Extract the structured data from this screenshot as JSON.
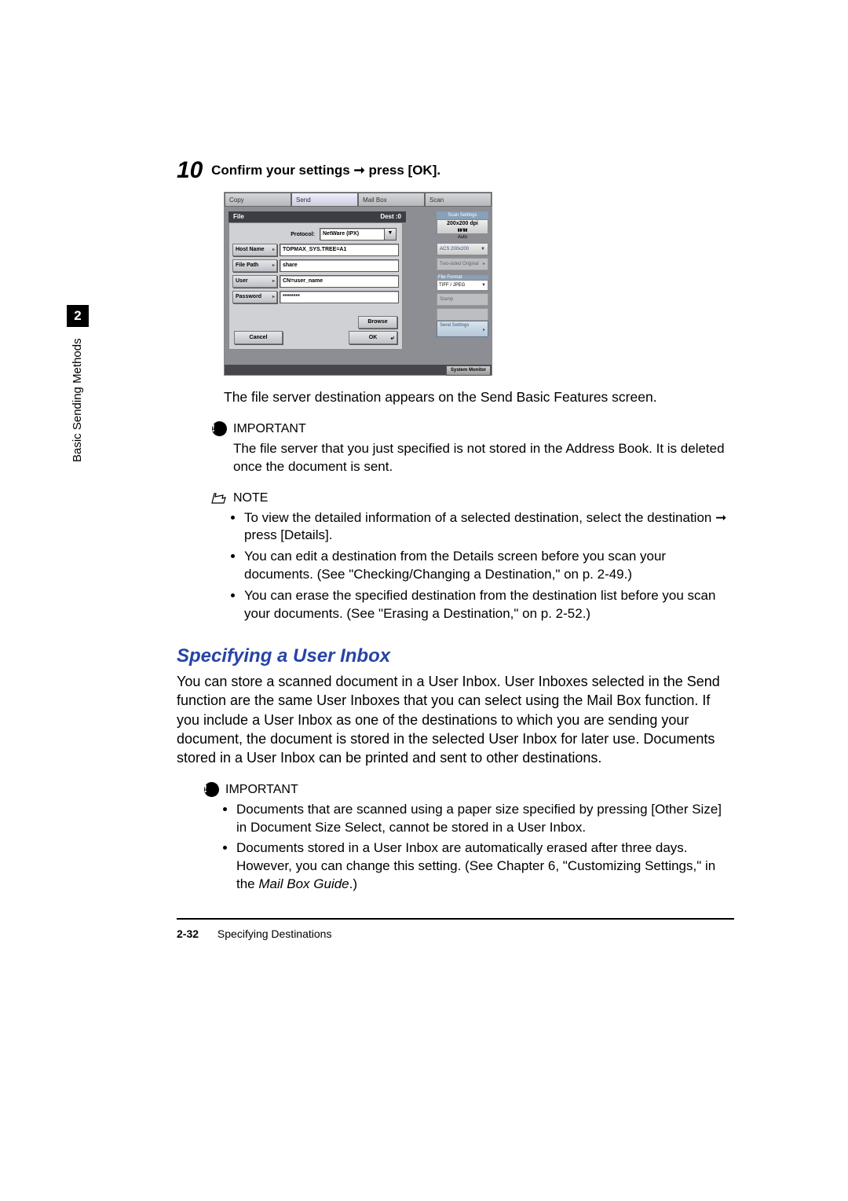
{
  "sidebar": {
    "chapter_num": "2",
    "chapter_label": "Basic Sending Methods"
  },
  "step": {
    "num": "10",
    "text_prefix": "Confirm your settings ",
    "text_suffix": " press [OK]."
  },
  "ui": {
    "tabs": {
      "copy": "Copy",
      "send": "Send",
      "mailbox": "Mail Box",
      "scan": "Scan"
    },
    "file_bar": {
      "left": "File",
      "right": "Dest :0"
    },
    "labels": {
      "protocol": "Protocol:",
      "host": "Host Name",
      "path": "File Path",
      "user": "User",
      "password": "Password"
    },
    "values": {
      "protocol": "NetWare (IPX)",
      "host": "TOPMAX_SYS.TREE=A1",
      "path": "share",
      "user": "CN=user_name",
      "password": "********"
    },
    "buttons": {
      "browse": "Browse",
      "cancel": "Cancel",
      "ok": "OK"
    },
    "right": {
      "scan_settings": "Scan Settings",
      "dpi": "200x200 dpi",
      "auto": "Auto",
      "acs": "ACS 200x200",
      "twosided": "Two-sided Original",
      "file_format": "File Format",
      "tiff": "TIFF / JPEG",
      "stamp": "Stamp",
      "done": "",
      "send_settings": "Send Settings"
    },
    "system_monitor": "System Monitor"
  },
  "after_screenshot": "The file server destination appears on the Send Basic Features screen.",
  "important1": {
    "label": "IMPORTANT",
    "text": "The file server that you just specified is not stored in the Address Book. It is deleted once the document is sent."
  },
  "note": {
    "label": "NOTE",
    "items": [
      "To view the detailed information of a selected destination, select the destination ➞ press [Details].",
      "You can edit a destination from the Details screen before you scan your documents. (See \"Checking/Changing a Destination,\" on p. 2-49.)",
      "You can erase the specified destination from the destination list before you scan your documents. (See \"Erasing a Destination,\" on p. 2-52.)"
    ]
  },
  "section": {
    "heading": "Specifying a User Inbox",
    "para": "You can store a scanned document in a User Inbox. User Inboxes selected in the Send function are the same User Inboxes that you can select using the Mail Box function. If you include a User Inbox as one of the destinations to which you are sending your document, the document is stored in the selected User Inbox for later use.  Documents stored in a User Inbox can be printed and sent to other destinations."
  },
  "important2": {
    "label": "IMPORTANT",
    "items": [
      "Documents that are scanned using a paper size specified by pressing [Other Size] in Document Size Select, cannot be stored in a User Inbox.",
      "Documents stored in a User Inbox are automatically erased after three days. However, you can change this setting. (See Chapter 6, \"Customizing Settings,\" in the Mail Box Guide.)"
    ]
  },
  "footer": {
    "page_num": "2-32",
    "title": "Specifying Destinations"
  }
}
